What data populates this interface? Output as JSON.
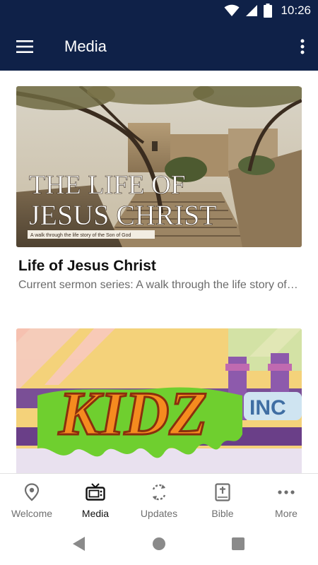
{
  "status_bar": {
    "time": "10:26"
  },
  "app_bar": {
    "title": "Media"
  },
  "cards": [
    {
      "title": "Life of Jesus Christ",
      "subtitle": "Current sermon series: A walk through the life story of the Son of God",
      "image_title_line1": "THE LIFE OF",
      "image_title_line2": "JESUS CHRIST",
      "image_tagline": "A walk through the life story of the Son of God"
    },
    {
      "image_text_main": "KIDZ",
      "image_text_side": "INC"
    }
  ],
  "bottom_nav": [
    {
      "label": "Welcome",
      "icon": "location-pin-icon",
      "active": false
    },
    {
      "label": "Media",
      "icon": "tv-icon",
      "active": true
    },
    {
      "label": "Updates",
      "icon": "sync-icon",
      "active": false
    },
    {
      "label": "Bible",
      "icon": "bible-icon",
      "active": false
    },
    {
      "label": "More",
      "icon": "more-dots-icon",
      "active": false
    }
  ],
  "colors": {
    "app_bar": "#0f2148",
    "active_nav": "#111111",
    "inactive_nav": "#6f6f6f"
  }
}
